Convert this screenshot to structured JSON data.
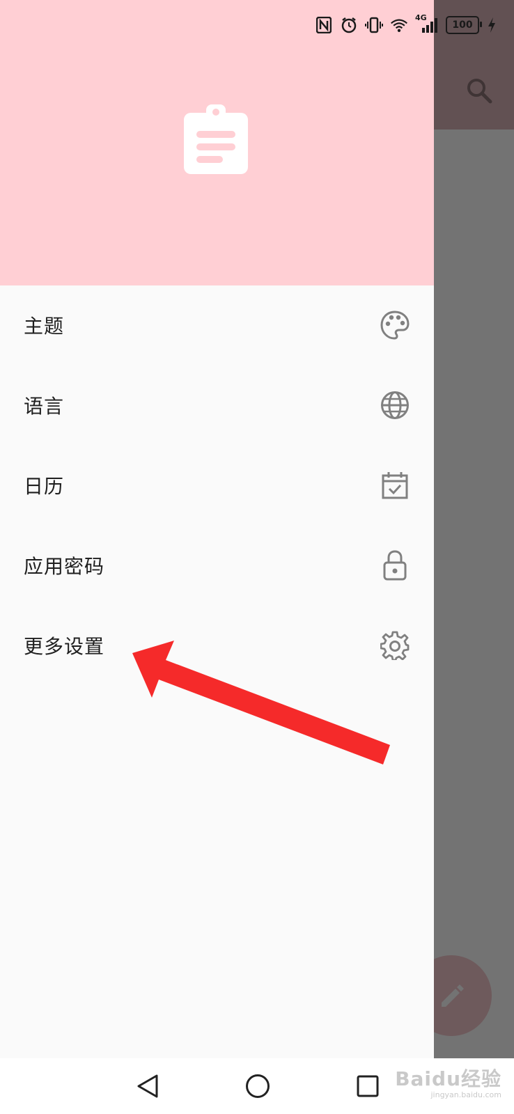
{
  "status_bar": {
    "battery_level": "100",
    "network": "4G",
    "icons": [
      "nfc-icon",
      "alarm-icon",
      "vibrate-icon",
      "wifi-icon",
      "signal-icon",
      "charging-icon"
    ]
  },
  "drawer": {
    "header": {
      "logo_icon": "clipboard-note-icon",
      "background_color": "#ffcfd4"
    },
    "menu_items": [
      {
        "label": "主题",
        "icon": "palette-icon"
      },
      {
        "label": "语言",
        "icon": "globe-icon"
      },
      {
        "label": "日历",
        "icon": "calendar-check-icon"
      },
      {
        "label": "应用密码",
        "icon": "lock-icon"
      },
      {
        "label": "更多设置",
        "icon": "gear-icon"
      }
    ]
  },
  "background_app": {
    "toolbar_icon": "search-icon",
    "fab_icon": "pencil-icon"
  },
  "nav_bar": {
    "buttons": [
      "back-triangle-icon",
      "home-circle-icon",
      "recents-square-icon"
    ]
  },
  "watermark": {
    "brand": "Baidu经验",
    "url": "jingyan.baidu.com"
  },
  "annotation": {
    "color": "#f52a2a",
    "type": "arrow"
  }
}
